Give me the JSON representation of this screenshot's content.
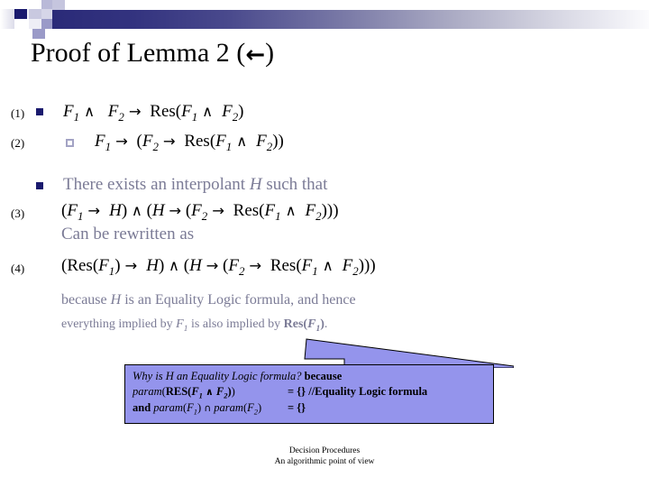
{
  "slide": {
    "title_text": "Proof of Lemma 2 (",
    "title_arrow": "←",
    "title_close": ")"
  },
  "bullets": {
    "level1_icon": "filled-square-bullet",
    "level2_icon": "hollow-square-bullet"
  },
  "lines": [
    {
      "number": "(1)",
      "text": "F1 ∧ F2 → Res(F1 ∧ F2)",
      "bullet": "level1"
    },
    {
      "number": "(2)",
      "text": "F1 → (F2 → Res(F1 ∧ F2))",
      "bullet": "level2"
    },
    {
      "number": "",
      "text": "There exists an interpolant H such that",
      "bullet": "level1"
    },
    {
      "number": "(3)",
      "text": "(F1 → H) ∧ (H → (F2 → Res(F1 ∧ F2)))",
      "bullet": ""
    },
    {
      "number": "",
      "text": "Can be rewritten as",
      "bullet": ""
    },
    {
      "number": "(4)",
      "text": "(Res(F1) → H) ∧ (H → (F2 → Res(F1 ∧ F2)))",
      "bullet": ""
    }
  ],
  "explanation": {
    "line1": "because H is an Equality Logic formula, and hence",
    "line2": "everything implied by F1 is also implied by Res(F1)."
  },
  "callout": {
    "line1_question": "Why is H an Equality Logic formula?",
    "line1_because": " because",
    "line2_left": "param(RES(F1 ∧ F2))",
    "line2_right": "= {} //Equality Logic formula",
    "line3_left": "and param(F1) ∩ param(F2)",
    "line3_right": "= {}"
  },
  "footer": {
    "line1": "Decision Procedures",
    "line2": "An algorithmic point of view"
  },
  "colors": {
    "bullet_level1": "#1a1a6e",
    "bullet_level2": "#a3a3c4",
    "grey_text": "#7b7b96",
    "callout_fill": "#9494ec",
    "header_navy": "#2a2a78"
  }
}
